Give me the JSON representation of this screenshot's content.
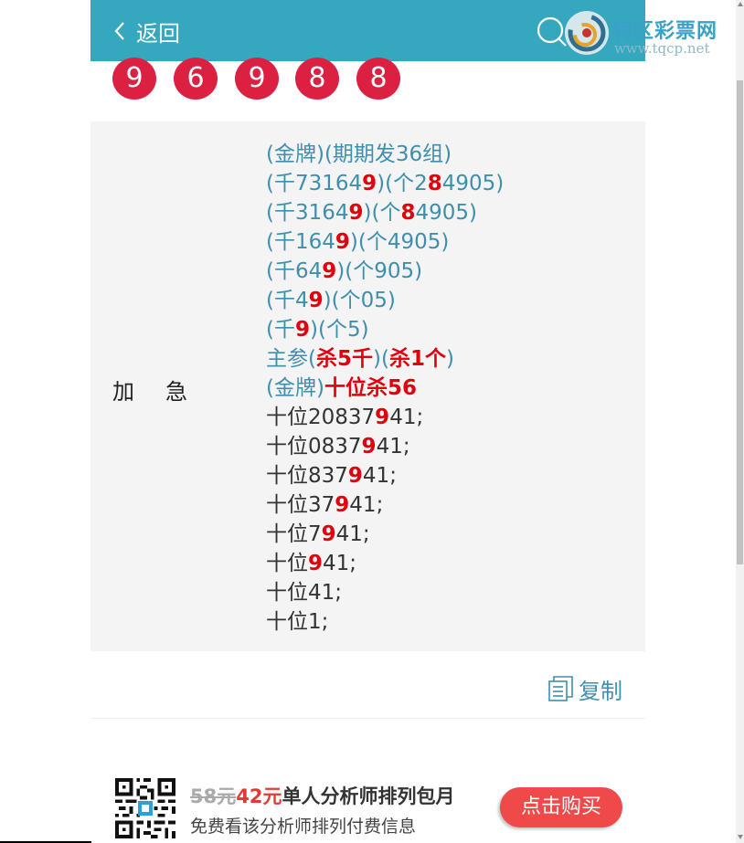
{
  "header": {
    "back_label": "返回",
    "logo_text": "特区彩票网",
    "logo_url_text": "www.tqcp.net"
  },
  "balls": [
    "9",
    "6",
    "9",
    "8",
    "8"
  ],
  "panel": {
    "label": "加急",
    "lines": [
      [
        {
          "t": "(金牌)(期期发36组)"
        }
      ],
      [
        {
          "t": "(千73164"
        },
        {
          "t": "9",
          "r": true
        },
        {
          "t": ")(个2"
        },
        {
          "t": "8",
          "r": true
        },
        {
          "t": "4905)"
        }
      ],
      [
        {
          "t": "(千3164"
        },
        {
          "t": "9",
          "r": true
        },
        {
          "t": ")(个"
        },
        {
          "t": "8",
          "r": true
        },
        {
          "t": "4905)"
        }
      ],
      [
        {
          "t": "(千164"
        },
        {
          "t": "9",
          "r": true
        },
        {
          "t": ")(个4905)"
        }
      ],
      [
        {
          "t": "(千64"
        },
        {
          "t": "9",
          "r": true
        },
        {
          "t": ")(个905)"
        }
      ],
      [
        {
          "t": "(千4"
        },
        {
          "t": "9",
          "r": true
        },
        {
          "t": ")(个05)"
        }
      ],
      [
        {
          "t": "(千"
        },
        {
          "t": "9",
          "r": true
        },
        {
          "t": ")(个5)"
        }
      ],
      [
        {
          "t": "主参("
        },
        {
          "t": "杀5千",
          "r": true
        },
        {
          "t": ")("
        },
        {
          "t": "杀1个",
          "r": true
        },
        {
          "t": ")"
        }
      ],
      [
        {
          "t": "(金牌)"
        },
        {
          "t": "十位杀56",
          "r": true
        }
      ],
      [
        {
          "t": "十位20837",
          "d": true
        },
        {
          "t": "9",
          "r": true
        },
        {
          "t": "41;",
          "d": true
        }
      ],
      [
        {
          "t": "十位0837",
          "d": true
        },
        {
          "t": "9",
          "r": true
        },
        {
          "t": "41;",
          "d": true
        }
      ],
      [
        {
          "t": "十位837",
          "d": true
        },
        {
          "t": "9",
          "r": true
        },
        {
          "t": "41;",
          "d": true
        }
      ],
      [
        {
          "t": "十位37",
          "d": true
        },
        {
          "t": "9",
          "r": true
        },
        {
          "t": "41;",
          "d": true
        }
      ],
      [
        {
          "t": "十位7",
          "d": true
        },
        {
          "t": "9",
          "r": true
        },
        {
          "t": "41;",
          "d": true
        }
      ],
      [
        {
          "t": "十位",
          "d": true
        },
        {
          "t": "9",
          "r": true
        },
        {
          "t": "41;",
          "d": true
        }
      ],
      [
        {
          "t": "十位41;",
          "d": true
        }
      ],
      [
        {
          "t": "十位1;",
          "d": true
        }
      ]
    ]
  },
  "copy_label": "复制",
  "promo": {
    "old_price": "58元",
    "new_price": "42元",
    "title_rest": "单人分析师排列包月",
    "subtitle": "免费看该分析师排列付费信息",
    "buy_label": "点击购买"
  },
  "colors": {
    "header_bg": "#35a8c0",
    "ball": "#dc2042",
    "link_text": "#3e8fae",
    "highlight": "#e0000f",
    "buy_button": "#f0494a"
  },
  "icons": [
    "chevron-left-icon",
    "search-icon",
    "copy-document-icon",
    "qr-code-icon"
  ]
}
